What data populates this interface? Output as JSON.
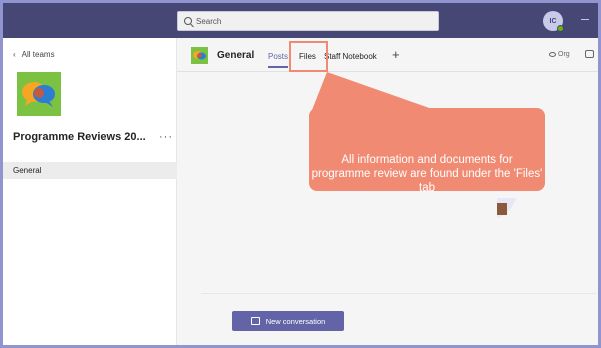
{
  "search": {
    "placeholder": "Search"
  },
  "user": {
    "initials": "IC"
  },
  "nav": {
    "back_label": "All teams"
  },
  "team": {
    "name": "Programme Reviews 20...",
    "more": "···"
  },
  "channels": [
    {
      "label": "General"
    }
  ],
  "channel": {
    "title": "General",
    "tabs": [
      {
        "label": "Posts"
      },
      {
        "label": "Files"
      },
      {
        "label": "Staff Notebook"
      }
    ],
    "add_tab": "+",
    "org_label": "Org"
  },
  "callout": {
    "text": "All information and documents for programme review are found under the 'Files' tab"
  },
  "actions": {
    "new_conversation": "New conversation"
  },
  "colors": {
    "topbar": "#464775",
    "accent": "#6264a7",
    "team_logo": "#7bc242",
    "callout": "#f08a72",
    "frame": "#9095d0"
  }
}
